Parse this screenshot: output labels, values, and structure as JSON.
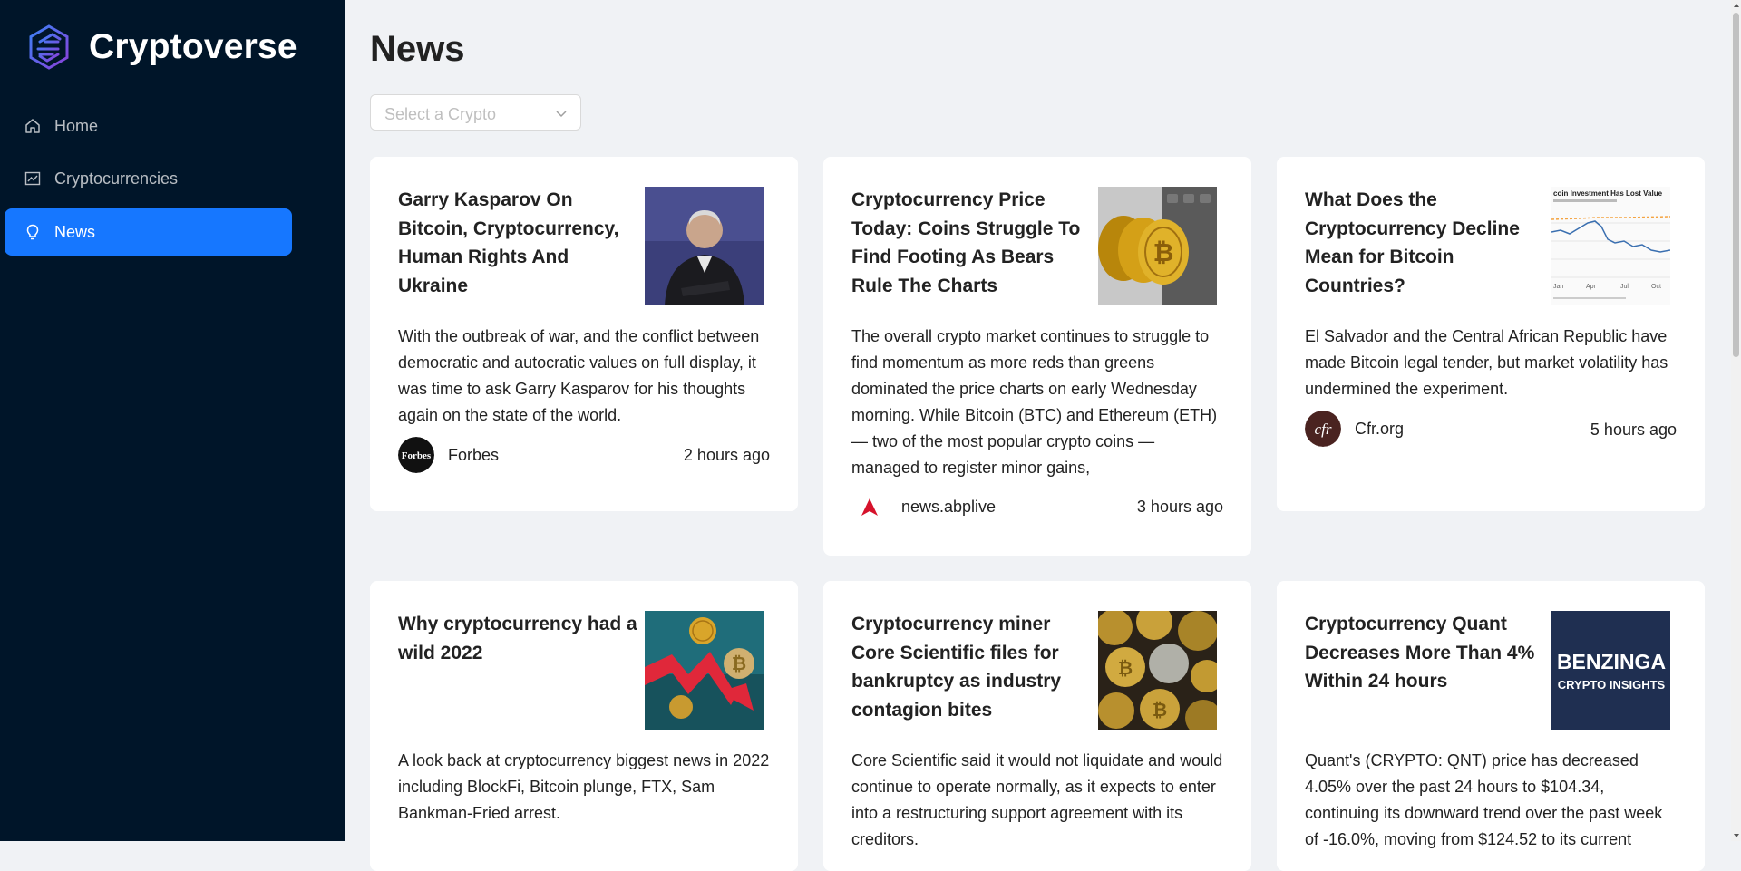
{
  "app": {
    "title": "Cryptoverse"
  },
  "nav": {
    "items": [
      {
        "label": "Home",
        "icon": "home-icon",
        "active": false
      },
      {
        "label": "Cryptocurrencies",
        "icon": "chart-icon",
        "active": false
      },
      {
        "label": "News",
        "icon": "bulb-icon",
        "active": true
      }
    ]
  },
  "page": {
    "title": "News"
  },
  "filter": {
    "placeholder": "Select a Crypto"
  },
  "colors": {
    "sidebar": "#001529",
    "accent": "#1677ff",
    "background": "#f0f2f5"
  },
  "articles": [
    {
      "title": "Garry Kasparov On Bitcoin, Cryptocurrency, Human Rights And Ukraine",
      "description": "With the outbreak of war, and the conflict between democratic and autocratic values on full display, it was time to ask Garry Kasparov for his thoughts again on the state of the world.",
      "provider": "Forbes",
      "provider_logo_text": "Forbes",
      "time": "2 hours ago"
    },
    {
      "title": "Cryptocurrency Price Today: Coins Struggle To Find Footing As Bears Rule The Charts",
      "description": "The overall crypto market continues to struggle to find momentum as more reds than greens dominated the price charts on early Wednesday morning. While Bitcoin (BTC) and Ethereum (ETH) — two of the most popular crypto coins — managed to register minor gains,",
      "provider": "news.abplive",
      "time": "3 hours ago"
    },
    {
      "title": "What Does the Cryptocurrency Decline Mean for Bitcoin Countries?",
      "description": "El Salvador and the Central African Republic have made Bitcoin legal tender, but market volatility has undermined the experiment.",
      "provider": "Cfr.org",
      "provider_logo_text": "cfr",
      "image_caption": "coin Investment Has Lost Value",
      "time": "5 hours ago"
    },
    {
      "title": "Why cryptocurrency had a wild 2022",
      "description": "A look back at cryptocurrency biggest news in 2022 including BlockFi, Bitcoin plunge, FTX, Sam Bankman-Fried arrest."
    },
    {
      "title": "Cryptocurrency miner Core Scientific files for bankruptcy as industry contagion bites",
      "description": "Core Scientific said it would not liquidate and would continue to operate normally, as it expects to enter into a restructuring support agreement with its creditors."
    },
    {
      "title": "Cryptocurrency Quant Decreases More Than 4% Within 24 hours",
      "description": "Quant's (CRYPTO: QNT) price has decreased 4.05% over the past 24 hours to $104.34, continuing its downward trend over the past week of -16.0%, moving from $124.52 to its current",
      "image_text_1": "BENZINGA",
      "image_text_2": "CRYPTO INSIGHTS"
    }
  ]
}
